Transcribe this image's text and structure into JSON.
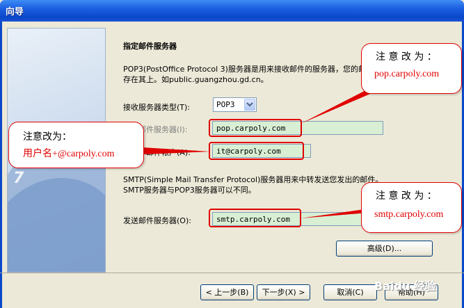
{
  "window": {
    "title": "向导"
  },
  "main": {
    "heading": "指定邮件服务器",
    "desc_line1": "POP3(PostOffice Protocol 3)服务器是用来接收邮件的服务器，您的邮件保",
    "desc_line2": "存在其上。如public.guangzhou.gd.cn。",
    "incoming_type_label": "接收服务器类型(T):",
    "incoming_type_value": "POP3",
    "incoming_server_label": "接收邮件服务器(I):",
    "incoming_server_value": "pop.carpoly.com",
    "account_label": "邮件帐户(A):",
    "account_value": "it@carpoly.com",
    "smtp_desc_line1": "SMTP(Simple Mail Transfer Protocol)服务器用来中转发送您发出的邮件。",
    "smtp_desc_line2": "SMTP服务器与POP3服务器可以不同。",
    "outgoing_server_label": "发送邮件服务器(O):",
    "outgoing_server_value": "smtp.carpoly.com",
    "advanced_button": "高级(D)..."
  },
  "footer": {
    "back_button": "< 上一步(B)",
    "next_button": "下一步(X) >",
    "cancel_button": "取消(C)",
    "help_button": "帮助(H)"
  },
  "annotations": {
    "note_pop_title": "注 意 改 为 ：",
    "note_pop_text": "pop.carpoly.com",
    "note_user_title": "注意改为：",
    "note_user_text": "用户名+@carpoly.com",
    "note_smtp_title": "注 意 改 为 ：",
    "note_smtp_text": "smtp.carpoly.com"
  },
  "watermark": "Baidu 经验",
  "colors": {
    "highlight": "#e00000",
    "field_bg": "#d8efd4",
    "titlebar": "#0a47c9"
  }
}
